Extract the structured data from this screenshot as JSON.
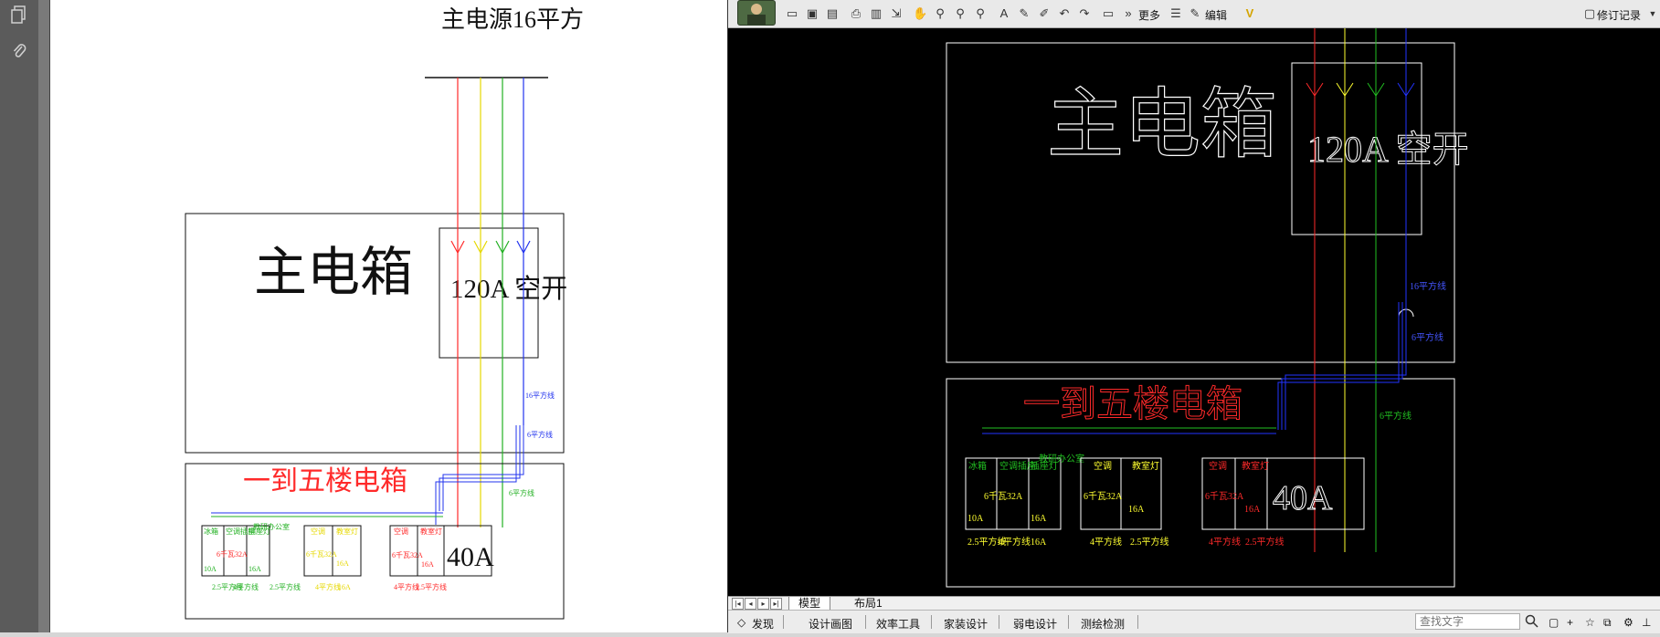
{
  "pdf": {
    "sidebar_icons": [
      "pages-icon",
      "attachment-icon"
    ],
    "title": "主电源16平方",
    "main_box": "主电箱",
    "breaker": "120A 空开",
    "wire16": "16平方线",
    "wire6": "6平方线",
    "wire6b": "6平方线",
    "floor_box": "一到五楼电箱",
    "office_label": "教研办公室",
    "labels_a": [
      "冰箱",
      "空调插座",
      "插座灯"
    ],
    "ac1": "空调",
    "lamp1": "教室灯",
    "ac2": "空调",
    "lamp2": "教室灯",
    "kw1": "6千瓦32A",
    "kw2": "6千瓦32A",
    "kw3": "6千瓦32A",
    "amp10": "10A",
    "amp16a": "16A",
    "amp16b": "16A",
    "amp16c": "16A",
    "amp16d": "16A",
    "big40": "40A",
    "wire_25": "2.5平方线",
    "wire_4": "4平方线"
  },
  "cad": {
    "toolbar": {
      "more_label": "更多",
      "edit_label": "编辑",
      "revision_label": "修订记录"
    },
    "drawing": {
      "main_box": "主电箱",
      "breaker": "120A 空开",
      "wire16": "16平方线",
      "wire6": "6平方线",
      "wire6b": "6平方线",
      "floor_box": "一到五楼电箱",
      "office_label": "教研办公室",
      "labels_a": [
        "冰箱",
        "空调插座",
        "插座灯"
      ],
      "ac1": "空调",
      "lamp1": "教室灯",
      "ac2": "空调",
      "lamp2": "教室灯",
      "kw1": "6千瓦32A",
      "kw2": "6千瓦32A",
      "kw3": "6千瓦32A",
      "amp10": "10A",
      "amp16a": "16A",
      "amp16b": "16A",
      "amp16c": "16A",
      "amp16d": "16A",
      "big40": "40A",
      "wire_25": "2.5平方线",
      "wire_4": "4平方线"
    },
    "tabs": [
      "模型",
      "布局1"
    ],
    "status": {
      "items": [
        "发现",
        "设计画图",
        "效率工具",
        "家装设计",
        "弱电设计",
        "测绘检测"
      ],
      "search_placeholder": "查找文字"
    }
  },
  "colors": {
    "red": "#ff2a2a",
    "yellow": "#ffff30",
    "green": "#22c022",
    "blue": "#2233ff"
  }
}
